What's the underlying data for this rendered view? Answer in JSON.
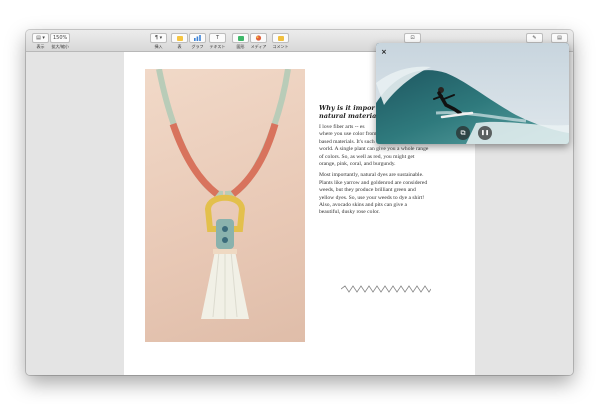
{
  "toolbar": {
    "view": {
      "label": "表示",
      "icon": "sidebar-view-icon"
    },
    "zoom": {
      "label": "拡大/縮小",
      "value": "150%"
    },
    "insert": {
      "label": "挿入",
      "icon": "paragraph-icon"
    },
    "table": {
      "label": "表",
      "icon": "table-icon"
    },
    "chart": {
      "label": "グラフ",
      "icon": "chart-icon"
    },
    "text": {
      "label": "テキスト",
      "icon": "text-icon"
    },
    "shape": {
      "label": "図形",
      "icon": "shape-icon"
    },
    "media": {
      "label": "メディア",
      "icon": "media-icon"
    },
    "comment": {
      "label": "コメント",
      "icon": "comment-icon"
    }
  },
  "article": {
    "headline_1": "Why is it impor",
    "headline_2": "natural materials",
    "para1": [
      "I love fiber arts -- es",
      "where you use color from plant- and insect-",
      "based materials. It's such a beautiful, vast",
      "world. A single plant can give you a whole range",
      "of colors. So, as well as red, you might get",
      "orange, pink, coral, and burgundy."
    ],
    "para2": [
      "Most importantly, natural dyes are sustainable.",
      "Plants like yarrow and goldenrod are considered",
      "weeds, but they produce brilliant green and",
      "yellow dyes. So, use your weeds to dye a shirt!",
      "Also, avocado skins and pits can give a",
      "beautiful, dusky rose color."
    ]
  },
  "pip": {
    "close_glyph": "×",
    "restore_glyph": "⧉",
    "pause_glyph": "❚❚"
  },
  "colors": {
    "accent_table": "#f5c542",
    "accent_chart": "#3b82d6",
    "accent_shape": "#3fb86a",
    "accent_comment": "#f0c040"
  }
}
